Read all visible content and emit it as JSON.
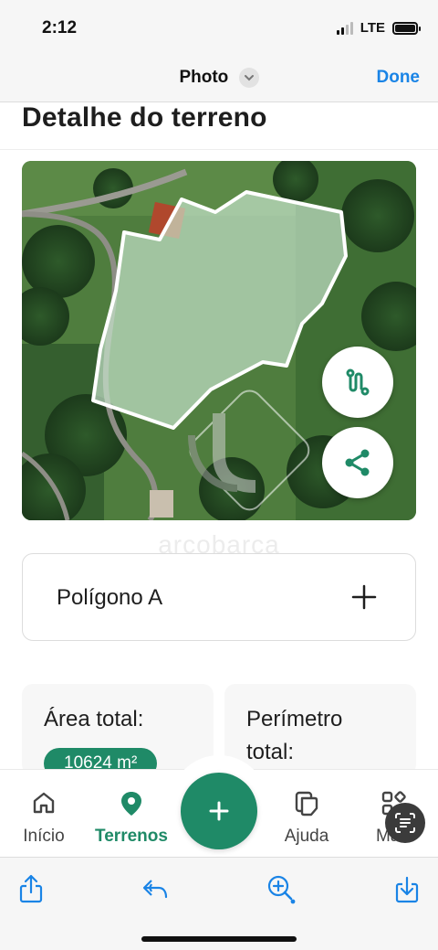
{
  "status": {
    "time": "2:12",
    "network": "LTE"
  },
  "viewer": {
    "title": "Photo",
    "done_label": "Done"
  },
  "page": {
    "title": "Detalhe do terreno",
    "watermark": "arcobarca"
  },
  "polygon": {
    "name": "Polígono A"
  },
  "stats": {
    "area_label": "Área total:",
    "area_value": "10624 m²",
    "perimeter_label_line1": "Perímetro",
    "perimeter_label_line2": "total:"
  },
  "tabs": [
    {
      "label": "Início",
      "icon": "home-icon"
    },
    {
      "label": "Terrenos",
      "icon": "map-pin-icon"
    },
    {
      "label": "Ajuda",
      "icon": "copy-icon"
    },
    {
      "label": "Mais",
      "icon": "grid-icon"
    }
  ],
  "colors": {
    "accent": "#1f8a67",
    "ios_blue": "#1a84e6",
    "polygon_fill": "#c9e6cf"
  }
}
